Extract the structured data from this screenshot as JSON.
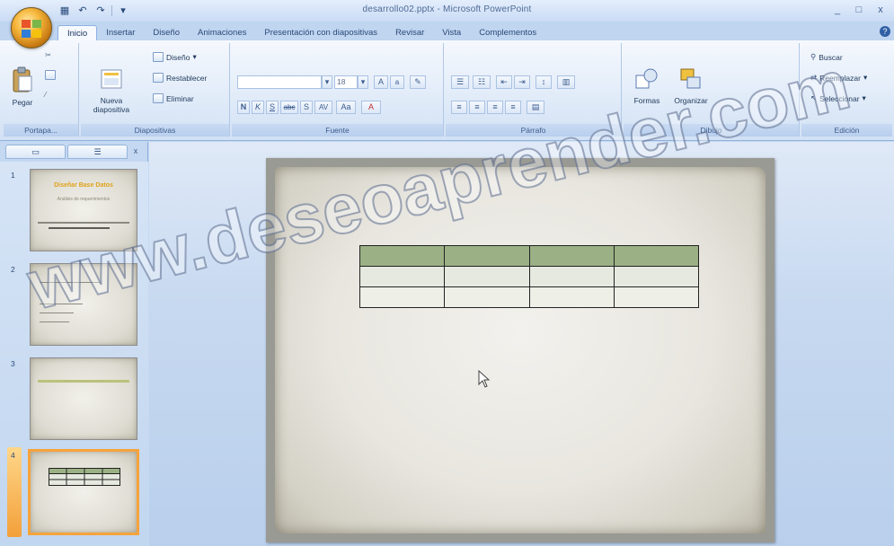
{
  "window": {
    "title": "desarrollo02.pptx - Microsoft PowerPoint",
    "controls": [
      "_",
      "□",
      "x"
    ]
  },
  "quick_access": [
    "save-icon",
    "undo-icon",
    "redo-icon",
    "customize-icon"
  ],
  "tabs": [
    {
      "label": "Inicio",
      "active": true
    },
    {
      "label": "Insertar"
    },
    {
      "label": "Diseño"
    },
    {
      "label": "Animaciones"
    },
    {
      "label": "Presentación con diapositivas"
    },
    {
      "label": "Revisar"
    },
    {
      "label": "Vista"
    },
    {
      "label": "Complementos"
    }
  ],
  "ribbon": {
    "portapapeles": {
      "label": "Portapa...",
      "paste": "Pegar"
    },
    "diapositivas": {
      "label": "Diapositivas",
      "new_slide_line1": "Nueva",
      "new_slide_line2": "diapositiva",
      "layout": "Diseño",
      "reset": "Restablecer",
      "delete": "Eliminar"
    },
    "fuente": {
      "label": "Fuente",
      "font_value": "",
      "size_value": "18",
      "bold": "N",
      "italic": "K",
      "underline": "S",
      "strike": "abc",
      "shadow": "S",
      "spacing": "AV",
      "case": "Aa",
      "color": "A"
    },
    "parrafo": {
      "label": "Párrafo"
    },
    "dibujo": {
      "label": "Dibujo",
      "shapes": "Formas",
      "arrange": "Organizar"
    },
    "edicion": {
      "label": "Edición",
      "find": "Buscar",
      "replace": "Reemplazar",
      "select": "Seleccionar"
    }
  },
  "left_pane": {
    "tab1": "Diapositivas",
    "tab2": "Esquema",
    "slides": [
      {
        "number": "1",
        "title": "Diseñar Base Datos",
        "subtitle": "Análisis de requerimientos"
      },
      {
        "number": "2"
      },
      {
        "number": "3"
      },
      {
        "number": "4",
        "selected": true
      }
    ]
  },
  "slide": {
    "table": {
      "rows": 3,
      "cols": 4,
      "header_color": "#9bb185"
    }
  },
  "watermark": "www.deseoaprender.com"
}
